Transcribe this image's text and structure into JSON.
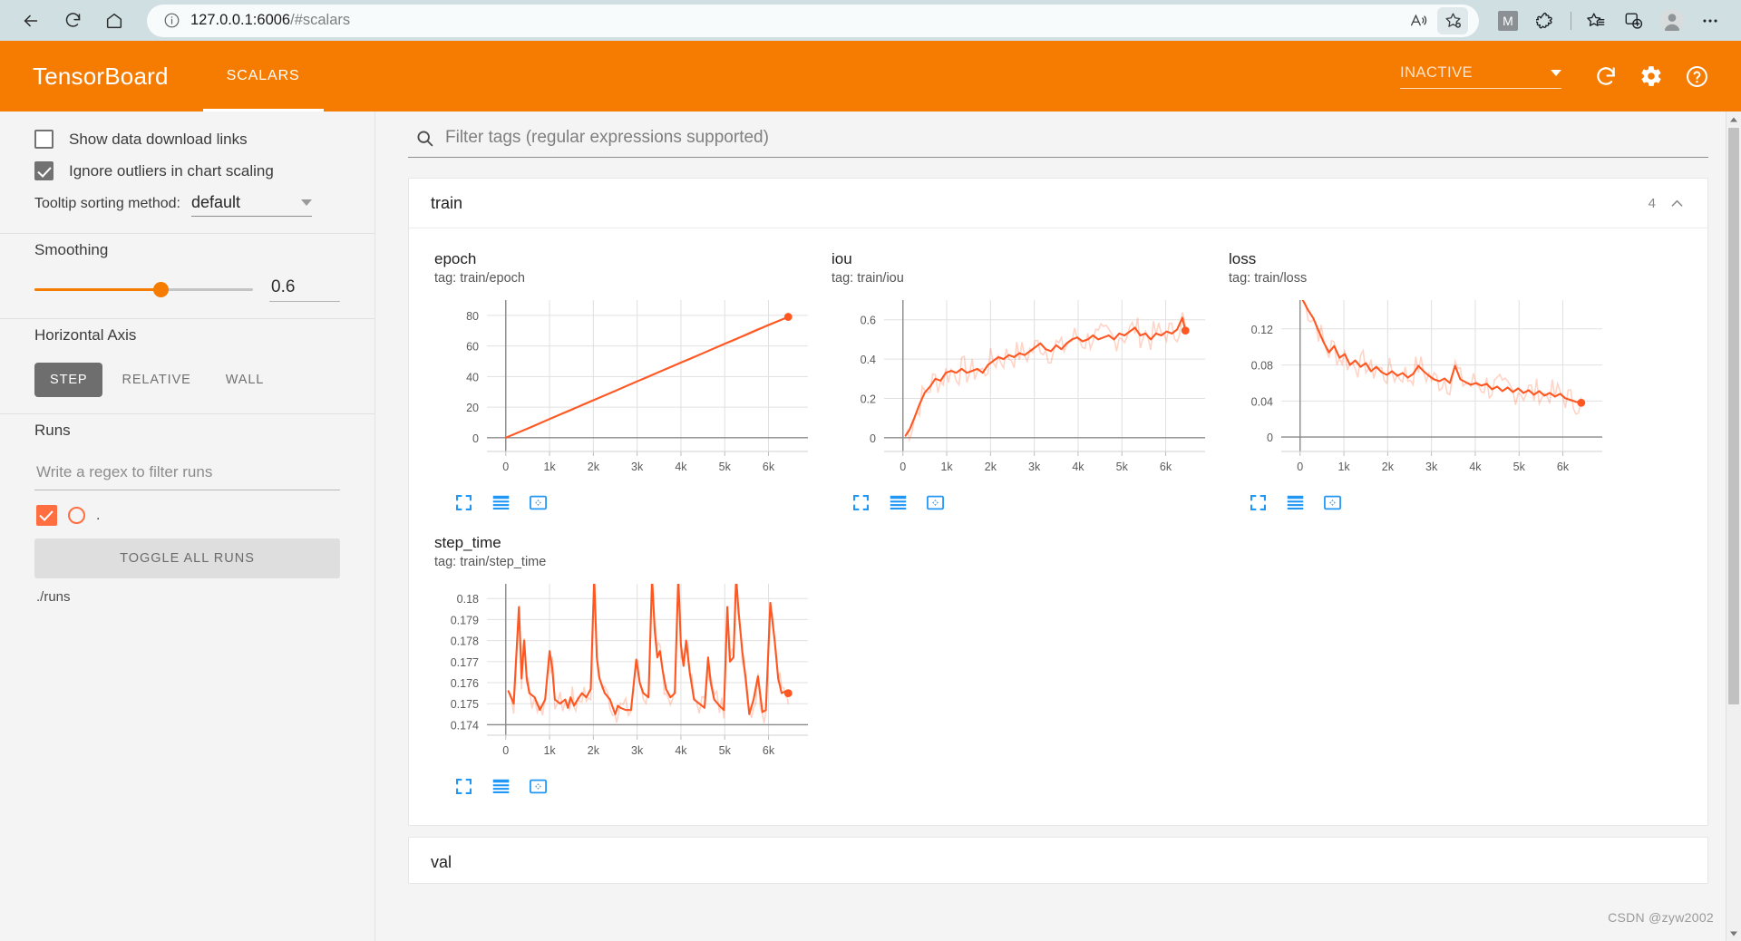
{
  "browser": {
    "back_label": "Back",
    "refresh_label": "Refresh",
    "home_label": "Home",
    "url_host": "127.0.0.1:6006",
    "url_path": "/#scalars",
    "url_full": "127.0.0.1:6006/#scalars",
    "read_aloud_icon": "read-aloud-icon",
    "favorite_icon": "add-favorite-icon",
    "profile_badge": "M",
    "extensions_icon": "extensions-icon",
    "collections_icon": "collections-icon",
    "split_screen_icon": "split-screen-icon",
    "profile_icon": "profile-avatar-icon",
    "settings_more_icon": "more-options-icon"
  },
  "header": {
    "logo": "TensorBoard",
    "tabs": [
      {
        "label": "SCALARS",
        "active": true
      }
    ],
    "run_status": "INACTIVE",
    "reload_icon": "reload-icon",
    "settings_icon": "gear-icon",
    "help_icon": "help-icon",
    "accent_color": "#f57c00"
  },
  "sidebar": {
    "show_download_links": {
      "label": "Show data download links",
      "checked": false
    },
    "ignore_outliers": {
      "label": "Ignore outliers in chart scaling",
      "checked": true
    },
    "tooltip_sorting": {
      "label": "Tooltip sorting method:",
      "value": "default"
    },
    "smoothing": {
      "title": "Smoothing",
      "value": "0.6",
      "percent": 58
    },
    "horizontal_axis": {
      "title": "Horizontal Axis",
      "options": [
        "STEP",
        "RELATIVE",
        "WALL"
      ],
      "selected": "STEP"
    },
    "runs": {
      "title": "Runs",
      "filter_placeholder": "Write a regex to filter runs",
      "items": [
        {
          "label": ".",
          "checked": true,
          "color": "#ff6e40"
        }
      ],
      "toggle_all_label": "TOGGLE ALL RUNS",
      "path": "./runs"
    }
  },
  "main": {
    "filter_placeholder": "Filter tags (regular expressions supported)",
    "search_icon": "search-icon",
    "groups": [
      {
        "title": "train",
        "count": "4",
        "collapse_icon": "chevron-up-icon",
        "charts": [
          {
            "name": "epoch",
            "tag": "tag: train/epoch",
            "tools": [
              "expand-icon",
              "data-table-icon",
              "fit-domain-icon"
            ]
          },
          {
            "name": "iou",
            "tag": "tag: train/iou",
            "tools": [
              "expand-icon",
              "data-table-icon",
              "fit-domain-icon"
            ]
          },
          {
            "name": "loss",
            "tag": "tag: train/loss",
            "tools": [
              "expand-icon",
              "data-table-icon",
              "fit-domain-icon"
            ]
          },
          {
            "name": "step_time",
            "tag": "tag: train/step_time",
            "tools": [
              "expand-icon",
              "data-table-icon",
              "fit-domain-icon"
            ]
          }
        ]
      },
      {
        "title": "val",
        "count": "",
        "collapse_icon": "chevron-up-icon",
        "charts": []
      }
    ]
  },
  "watermark": "CSDN @zyw2002",
  "chart_data": [
    {
      "type": "line",
      "title": "epoch",
      "subtitle": "tag: train/epoch",
      "xlabel": "",
      "ylabel": "",
      "xticks": [
        0,
        1000,
        2000,
        3000,
        4000,
        5000,
        6000
      ],
      "xticklabels": [
        "0",
        "1k",
        "2k",
        "3k",
        "4k",
        "5k",
        "6k"
      ],
      "yticks": [
        0,
        20,
        40,
        60,
        80
      ],
      "yticklabels": [
        "0",
        "20",
        "40",
        "60",
        "80"
      ],
      "xlim": [
        -430,
        6900
      ],
      "ylim": [
        -9,
        90
      ],
      "grid": true,
      "legend": "none",
      "series": [
        {
          "name": "./runs",
          "color": "#ff5722",
          "x": [
            0,
            500,
            1000,
            1500,
            2000,
            2500,
            3000,
            3500,
            4000,
            4500,
            5000,
            5500,
            6000,
            6450
          ],
          "values": [
            0,
            6,
            12.2,
            18.3,
            24.5,
            30.6,
            36.8,
            43,
            49.1,
            55.2,
            61.4,
            67.5,
            73.7,
            79
          ]
        }
      ],
      "last_point": {
        "x": 6450,
        "y": 79
      }
    },
    {
      "type": "line",
      "title": "iou",
      "subtitle": "tag: train/iou",
      "xlabel": "",
      "ylabel": "",
      "xticks": [
        0,
        1000,
        2000,
        3000,
        4000,
        5000,
        6000
      ],
      "xticklabels": [
        "0",
        "1k",
        "2k",
        "3k",
        "4k",
        "5k",
        "6k"
      ],
      "yticks": [
        0,
        0.2,
        0.4,
        0.6
      ],
      "yticklabels": [
        "0",
        "0.2",
        "0.4",
        "0.6"
      ],
      "xlim": [
        -430,
        6900
      ],
      "ylim": [
        -0.07,
        0.7
      ],
      "grid": true,
      "legend": "none",
      "series": [
        {
          "name": "./runs",
          "color": "#ff5722",
          "x": [
            60,
            150,
            260,
            380,
            500,
            620,
            740,
            860,
            980,
            1100,
            1220,
            1340,
            1460,
            1580,
            1700,
            1820,
            1940,
            2060,
            2180,
            2300,
            2420,
            2540,
            2660,
            2780,
            2900,
            3020,
            3140,
            3260,
            3380,
            3500,
            3620,
            3740,
            3860,
            3980,
            4100,
            4220,
            4340,
            4460,
            4580,
            4700,
            4820,
            4940,
            5060,
            5180,
            5300,
            5420,
            5540,
            5660,
            5780,
            5900,
            6020,
            6140,
            6260,
            6380,
            6450
          ],
          "values": [
            0.01,
            0.04,
            0.1,
            0.17,
            0.23,
            0.26,
            0.3,
            0.29,
            0.33,
            0.34,
            0.33,
            0.35,
            0.33,
            0.34,
            0.35,
            0.33,
            0.37,
            0.39,
            0.41,
            0.4,
            0.42,
            0.41,
            0.43,
            0.42,
            0.44,
            0.46,
            0.48,
            0.45,
            0.44,
            0.47,
            0.45,
            0.48,
            0.5,
            0.51,
            0.49,
            0.5,
            0.52,
            0.5,
            0.51,
            0.52,
            0.5,
            0.53,
            0.52,
            0.54,
            0.56,
            0.52,
            0.53,
            0.5,
            0.53,
            0.52,
            0.54,
            0.53,
            0.55,
            0.61,
            0.545
          ]
        }
      ],
      "last_point": {
        "x": 6450,
        "y": 0.545
      }
    },
    {
      "type": "line",
      "title": "loss",
      "subtitle": "tag: train/loss",
      "xlabel": "",
      "ylabel": "",
      "xticks": [
        0,
        1000,
        2000,
        3000,
        4000,
        5000,
        6000
      ],
      "xticklabels": [
        "0",
        "1k",
        "2k",
        "3k",
        "4k",
        "5k",
        "6k"
      ],
      "yticks": [
        0,
        0.04,
        0.08,
        0.12
      ],
      "yticklabels": [
        "0",
        "0.04",
        "0.08",
        "0.12"
      ],
      "xlim": [
        -430,
        6900
      ],
      "ylim": [
        -0.016,
        0.152
      ],
      "grid": true,
      "legend": "none",
      "series": [
        {
          "name": "./runs",
          "color": "#ff5722",
          "x": [
            60,
            180,
            300,
            420,
            540,
            660,
            780,
            900,
            1020,
            1140,
            1260,
            1380,
            1500,
            1620,
            1740,
            1860,
            1980,
            2100,
            2220,
            2340,
            2460,
            2580,
            2700,
            2820,
            2940,
            3060,
            3180,
            3300,
            3420,
            3540,
            3660,
            3780,
            3900,
            4020,
            4140,
            4260,
            4380,
            4500,
            4620,
            4740,
            4860,
            4980,
            5100,
            5220,
            5340,
            5460,
            5580,
            5700,
            5820,
            5940,
            6060,
            6180,
            6300,
            6420
          ],
          "values": [
            0.152,
            0.141,
            0.132,
            0.118,
            0.105,
            0.094,
            0.101,
            0.088,
            0.092,
            0.08,
            0.085,
            0.078,
            0.082,
            0.073,
            0.078,
            0.072,
            0.069,
            0.073,
            0.068,
            0.071,
            0.066,
            0.07,
            0.079,
            0.073,
            0.068,
            0.064,
            0.062,
            0.065,
            0.06,
            0.079,
            0.064,
            0.061,
            0.058,
            0.06,
            0.057,
            0.059,
            0.053,
            0.056,
            0.051,
            0.055,
            0.05,
            0.054,
            0.049,
            0.052,
            0.047,
            0.051,
            0.046,
            0.049,
            0.045,
            0.048,
            0.043,
            0.041,
            0.039,
            0.038
          ]
        }
      ],
      "last_point": {
        "x": 6420,
        "y": 0.038
      }
    },
    {
      "type": "line",
      "title": "step_time",
      "subtitle": "tag: train/step_time",
      "xlabel": "",
      "ylabel": "",
      "xticks": [
        0,
        1000,
        2000,
        3000,
        4000,
        5000,
        6000
      ],
      "xticklabels": [
        "0",
        "1k",
        "2k",
        "3k",
        "4k",
        "5k",
        "6k"
      ],
      "yticks": [
        0.174,
        0.175,
        0.176,
        0.177,
        0.178,
        0.179,
        0.18
      ],
      "yticklabels": [
        "0.174",
        "0.175",
        "0.176",
        "0.177",
        "0.178",
        "0.179",
        "0.18"
      ],
      "xlim": [
        -430,
        6900
      ],
      "ylim": [
        0.1735,
        0.1807
      ],
      "grid": true,
      "legend": "none",
      "series": [
        {
          "name": "./runs",
          "color": "#ff5722",
          "x": [
            60,
            180,
            300,
            360,
            420,
            480,
            540,
            660,
            780,
            900,
            1000,
            1060,
            1120,
            1240,
            1360,
            1420,
            1480,
            1560,
            1640,
            1740,
            1840,
            1940,
            2020,
            2080,
            2140,
            2260,
            2380,
            2500,
            2560,
            2620,
            2740,
            2860,
            2980,
            3060,
            3140,
            3260,
            3340,
            3400,
            3460,
            3520,
            3580,
            3660,
            3760,
            3860,
            3940,
            4000,
            4060,
            4120,
            4200,
            4300,
            4420,
            4540,
            4620,
            4680,
            4760,
            4880,
            4980,
            5060,
            5120,
            5200,
            5260,
            5320,
            5400,
            5480,
            5560,
            5660,
            5760,
            5860,
            5940,
            6040,
            6140,
            6220,
            6300,
            6400,
            6450
          ],
          "values": [
            0.1756,
            0.175,
            0.1796,
            0.1762,
            0.178,
            0.1762,
            0.1755,
            0.1753,
            0.1747,
            0.1752,
            0.1775,
            0.1767,
            0.1752,
            0.175,
            0.1752,
            0.1748,
            0.1753,
            0.1749,
            0.1752,
            0.1755,
            0.1753,
            0.1757,
            0.181,
            0.1772,
            0.1762,
            0.1755,
            0.1752,
            0.1745,
            0.1749,
            0.1748,
            0.1747,
            0.1747,
            0.1771,
            0.176,
            0.1755,
            0.1753,
            0.181,
            0.1785,
            0.1772,
            0.1775,
            0.1766,
            0.1757,
            0.1753,
            0.1755,
            0.181,
            0.1778,
            0.1768,
            0.178,
            0.1765,
            0.1752,
            0.175,
            0.1748,
            0.1772,
            0.176,
            0.1752,
            0.1749,
            0.1747,
            0.1796,
            0.177,
            0.1772,
            0.181,
            0.1793,
            0.1775,
            0.1762,
            0.1745,
            0.1752,
            0.1763,
            0.1746,
            0.1747,
            0.1798,
            0.178,
            0.1762,
            0.1755,
            0.1756,
            0.1755
          ]
        }
      ],
      "last_point": {
        "x": 6450,
        "y": 0.1755
      }
    }
  ]
}
